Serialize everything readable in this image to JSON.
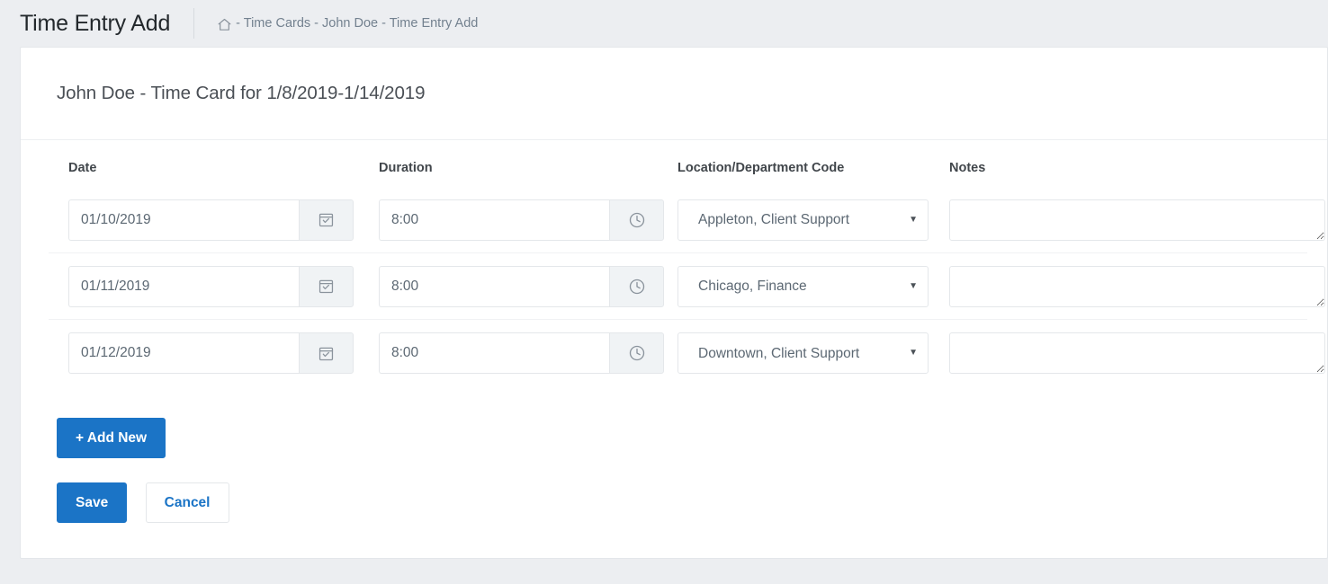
{
  "header": {
    "page_title": "Time Entry Add",
    "breadcrumb": {
      "home_icon": "home-icon",
      "text": "- Time Cards - John Doe - Time Entry Add"
    }
  },
  "card": {
    "title": "John Doe - Time Card for 1/8/2019-1/14/2019",
    "columns": [
      {
        "key": "date",
        "label": "Date"
      },
      {
        "key": "duration",
        "label": "Duration"
      },
      {
        "key": "location",
        "label": "Location/Department Code"
      },
      {
        "key": "notes",
        "label": "Notes"
      }
    ],
    "rows": [
      {
        "date": "01/10/2019",
        "date_icon": "calendar-icon",
        "duration": "8:00",
        "duration_icon": "clock-icon",
        "location": "Appleton, Client Support",
        "notes": ""
      },
      {
        "date": "01/11/2019",
        "date_icon": "calendar-icon",
        "duration": "8:00",
        "duration_icon": "clock-icon",
        "location": "Chicago, Finance",
        "notes": ""
      },
      {
        "date": "01/12/2019",
        "date_icon": "calendar-icon",
        "duration": "8:00",
        "duration_icon": "clock-icon",
        "location": "Downtown, Client Support",
        "notes": ""
      }
    ],
    "buttons": {
      "add_new": "+ Add New",
      "save": "Save",
      "cancel": "Cancel"
    }
  },
  "colors": {
    "primary": "#1b74c6",
    "page_background": "#eceef1",
    "card_background": "#ffffff",
    "border": "#e4e7ea",
    "text": "#5c6873",
    "heading": "#41464b",
    "muted": "#73818f"
  }
}
